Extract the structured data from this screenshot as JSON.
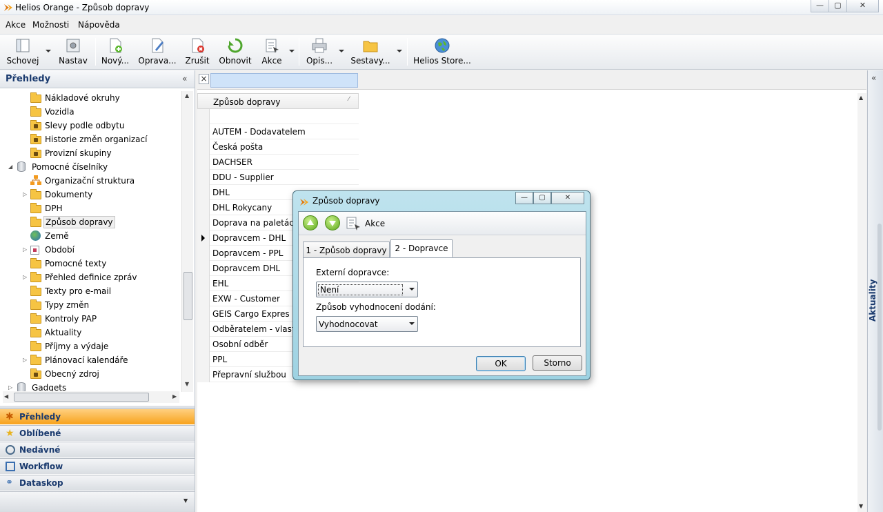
{
  "window": {
    "title": "Helios Orange - Způsob dopravy",
    "minimize": "—",
    "maximize": "▢",
    "close": "✕"
  },
  "menu": [
    "Akce",
    "Možnosti",
    "Nápověda"
  ],
  "toolbar": {
    "schovej": "Schovej",
    "nastav": "Nastav",
    "novy": "Nový...",
    "oprava": "Oprava...",
    "zrusit": "Zrušit",
    "obnovit": "Obnovit",
    "akce": "Akce",
    "opis": "Opis...",
    "sestavy": "Sestavy...",
    "store": "Helios Store..."
  },
  "left_panel": {
    "title": "Přehledy",
    "collapse": "«",
    "tree": [
      {
        "label": "Nákladové okruhy",
        "icon": "folder-icon"
      },
      {
        "label": "Vozidla",
        "icon": "folder-icon"
      },
      {
        "label": "Slevy podle odbytu",
        "icon": "lock-folder-icon"
      },
      {
        "label": "Historie změn organizací",
        "icon": "lock-folder-icon"
      },
      {
        "label": "Provizní skupiny",
        "icon": "lock-folder-icon"
      },
      {
        "label": "Pomocné číselníky",
        "icon": "database-icon"
      },
      {
        "label": "Organizační struktura",
        "icon": "org-structure-icon"
      },
      {
        "label": "Dokumenty",
        "icon": "folder-icon"
      },
      {
        "label": "DPH",
        "icon": "folder-icon"
      },
      {
        "label": "Způsob dopravy",
        "icon": "folder-icon"
      },
      {
        "label": "Země",
        "icon": "globe-icon"
      },
      {
        "label": "Období",
        "icon": "calendar-icon"
      },
      {
        "label": "Pomocné texty",
        "icon": "folder-icon"
      },
      {
        "label": "Přehled definice zpráv",
        "icon": "folder-icon"
      },
      {
        "label": "Texty pro e-mail",
        "icon": "folder-icon"
      },
      {
        "label": "Typy změn",
        "icon": "folder-icon"
      },
      {
        "label": "Kontroly PAP",
        "icon": "folder-icon"
      },
      {
        "label": "Aktuality",
        "icon": "folder-icon"
      },
      {
        "label": "Příjmy a výdaje",
        "icon": "folder-icon"
      },
      {
        "label": "Plánovací kalendáře",
        "icon": "folder-icon"
      },
      {
        "label": "Obecný zdroj",
        "icon": "lock-folder-icon"
      },
      {
        "label": "Gadgets",
        "icon": "database-icon"
      }
    ],
    "nav": [
      "Přehledy",
      "Oblíbené",
      "Nedávné",
      "Workflow",
      "Dataskop"
    ]
  },
  "grid": {
    "column": "Způsob dopravy",
    "sort_icon": "sort-indicator-icon",
    "rows": [
      "",
      "AUTEM - Dodavatelem",
      "Česká pošta",
      "DACHSER",
      "DDU - Supplier",
      "DHL",
      "DHL Rokycany",
      "Doprava na paletác",
      "Dopravcem - DHL",
      "Dopravcem - PPL",
      "Dopravcem DHL",
      "EHL",
      "EXW - Customer",
      "GEIS Cargo Expres",
      "Odběratelem - vlast",
      "Osobní odběr",
      "PPL",
      "Přepravní službou"
    ],
    "current_row_index": 8
  },
  "right_sidebar": {
    "label": "Aktuality",
    "expand": "«"
  },
  "dialog": {
    "title": "Způsob dopravy",
    "toolbar_akce": "Akce",
    "tabs": [
      "1 - Způsob dopravy",
      "2 - Dopravce"
    ],
    "active_tab": 1,
    "field1_label": "Externí dopravce:",
    "field1_value": "Není",
    "field2_label": "Způsob vyhodnocení dodání:",
    "field2_value": "Vyhodnocovat",
    "ok": "OK",
    "cancel": "Storno"
  }
}
